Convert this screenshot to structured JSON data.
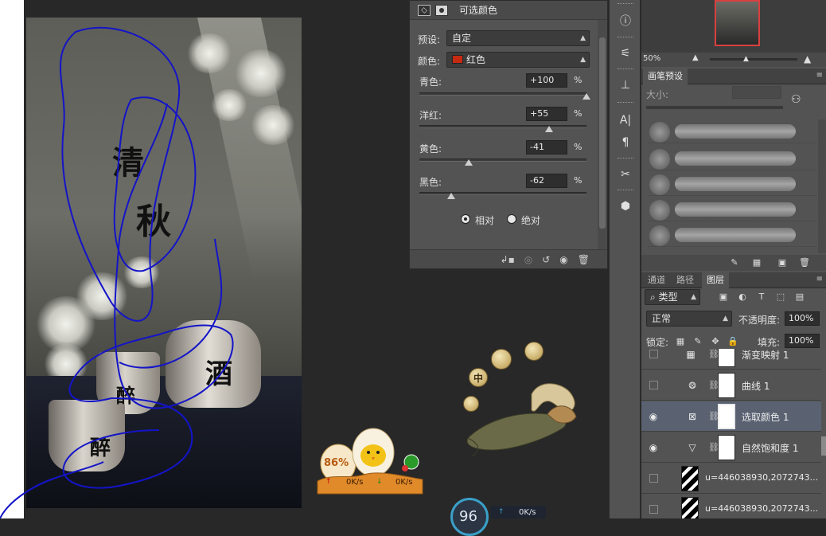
{
  "selective_color": {
    "title": "可选颜色",
    "preset_label": "预设:",
    "preset_value": "自定",
    "colors_label": "颜色:",
    "colors_value": "红色",
    "swatch_color": "#c62b12",
    "sliders": [
      {
        "label": "青色:",
        "value": "+100",
        "unit": "%",
        "level": 1.0
      },
      {
        "label": "洋红:",
        "value": "+55",
        "unit": "%",
        "level": 0.775
      },
      {
        "label": "黄色:",
        "value": "-41",
        "unit": "%",
        "level": 0.295
      },
      {
        "label": "黑色:",
        "value": "-62",
        "unit": "%",
        "level": 0.19
      }
    ],
    "method_relative": "相对",
    "method_absolute": "绝对",
    "method_selected": "relative"
  },
  "navigator": {
    "zoom": "50%"
  },
  "brush_preset": {
    "tab": "画笔预设",
    "size_label": "大小:"
  },
  "layers_panel": {
    "tabs": [
      "通道",
      "路径",
      "图层"
    ],
    "active_tab": "图层",
    "filter_label": "类型",
    "blend_mode": "正常",
    "opacity_label": "不透明度:",
    "opacity_value": "100%",
    "lock_label": "锁定:",
    "fill_label": "填充:",
    "fill_value": "100%",
    "layers": [
      {
        "name": "渐变映射 1",
        "visible": false,
        "type": "adjustment",
        "selected": false
      },
      {
        "name": "曲线 1",
        "visible": false,
        "type": "adjustment",
        "selected": false
      },
      {
        "name": "选取颜色 1",
        "visible": true,
        "type": "adjustment",
        "selected": true
      },
      {
        "name": "自然饱和度 1",
        "visible": true,
        "type": "adjustment",
        "selected": false
      },
      {
        "name": "u=446038930,2072743...",
        "visible": false,
        "type": "image",
        "selected": false
      },
      {
        "name": "u=446038930,2072743...",
        "visible": false,
        "type": "image",
        "selected": false
      }
    ]
  },
  "overlay": {
    "coins": [
      "中",
      "",
      "",
      ""
    ],
    "progress_percent": "86%",
    "upload_speed": "0K/s",
    "download_speed": "0K/s",
    "speed_readout": "0K/s",
    "gauge_value": "96"
  },
  "colors": {
    "selection": "#5a6272",
    "accent_red": "#d94040",
    "scribble": "#1414c8"
  }
}
